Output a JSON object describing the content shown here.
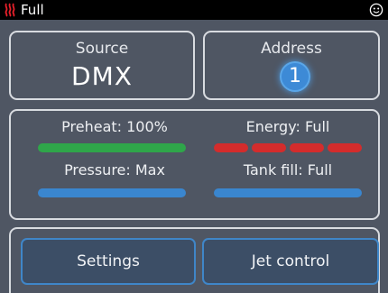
{
  "status_bar": {
    "mode_text": "Full",
    "heat_icon": "heat-waves-icon",
    "heat_icon_color": "#e8202a",
    "smiley_icon": "smiley-face-icon"
  },
  "source": {
    "label": "Source",
    "value": "DMX"
  },
  "address": {
    "label": "Address",
    "value": "1"
  },
  "status": {
    "preheat": {
      "label": "Preheat: 100%",
      "level": 1.0,
      "color": "#2fa64a"
    },
    "energy": {
      "label": "Energy: Full",
      "segments_filled": 4,
      "segments_total": 4,
      "color": "#d42c2c"
    },
    "pressure": {
      "label": "Pressure: Max",
      "level": 1.0,
      "color": "#3a86cf"
    },
    "tank_fill": {
      "label": "Tank fill: Full",
      "level": 1.0,
      "color": "#3a86cf"
    }
  },
  "nav": {
    "settings_label": "Settings",
    "jet_control_label": "Jet control"
  },
  "colors": {
    "background": "#4f5663",
    "panel_border": "#d8dbe0",
    "button_fill": "#3c4e66",
    "button_border": "#3f86c8",
    "accent": "#3d8ad6"
  }
}
